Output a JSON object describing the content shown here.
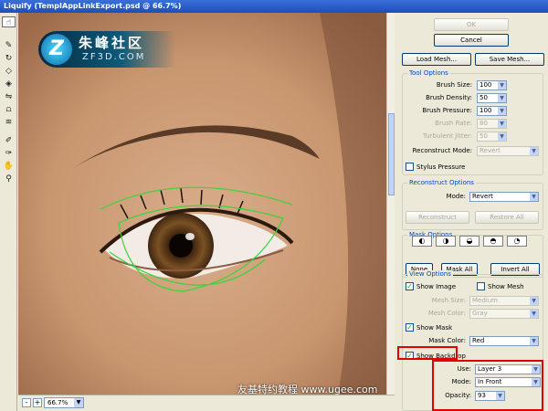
{
  "window": {
    "title": "Liquify (TempIAppLinkExport.psd @ 66.7%)"
  },
  "logo": {
    "glyph": "Z",
    "cn": "朱峰社区",
    "en": "ZF3D.COM"
  },
  "watermark": {
    "text": "友基特约教程 www.ugee.com"
  },
  "status": {
    "zoom": "66.7%",
    "zoom_out": "-",
    "zoom_in": "+"
  },
  "tools": [
    "warp-icon",
    "reconstruct-icon",
    "twirl-icon",
    "pucker-icon",
    "bloat-icon",
    "push-left-icon",
    "mirror-icon",
    "turbulence-icon",
    "freeze-mask-icon",
    "thaw-mask-icon",
    "hand-icon",
    "zoom-icon"
  ],
  "buttons": {
    "ok": "OK",
    "cancel": "Cancel",
    "load_mesh": "Load Mesh...",
    "save_mesh": "Save Mesh..."
  },
  "tool_options": {
    "title": "Tool Options",
    "brush_size_label": "Brush Size:",
    "brush_size": "100",
    "brush_density_label": "Brush Density:",
    "brush_density": "50",
    "brush_pressure_label": "Brush Pressure:",
    "brush_pressure": "100",
    "brush_rate_label": "Brush Rate:",
    "brush_rate": "80",
    "turbulent_jitter_label": "Turbulent Jitter:",
    "turbulent_jitter": "50",
    "reconstruct_mode_label": "Reconstruct Mode:",
    "reconstruct_mode": "Revert",
    "stylus_pressure_label": "Stylus Pressure",
    "stylus_pressure": false
  },
  "reconstruct_options": {
    "title": "Reconstruct Options",
    "mode_label": "Mode:",
    "mode": "Revert",
    "reconstruct_btn": "Reconstruct",
    "restore_all_btn": "Restore All"
  },
  "mask_options": {
    "title": "Mask Options",
    "none_btn": "None",
    "mask_all_btn": "Mask All",
    "invert_all_btn": "Invert All"
  },
  "view_options": {
    "title": "View Options",
    "show_image_label": "Show Image",
    "show_image": true,
    "show_mesh_label": "Show Mesh",
    "show_mesh": false,
    "mesh_size_label": "Mesh Size:",
    "mesh_size": "Medium",
    "mesh_color_label": "Mesh Color:",
    "mesh_color": "Gray",
    "show_mask_label": "Show Mask",
    "show_mask": true,
    "mask_color_label": "Mask Color:",
    "mask_color": "Red",
    "show_backdrop_label": "Show Backdrop",
    "show_backdrop": true,
    "use_label": "Use:",
    "use": "Layer 3",
    "mode_label": "Mode:",
    "mode": "In Front",
    "opacity_label": "Opacity:",
    "opacity": "93"
  },
  "colors": {
    "highlight": "#e00000",
    "group_title": "#0046d5",
    "mask_line": "#3bd43b"
  }
}
